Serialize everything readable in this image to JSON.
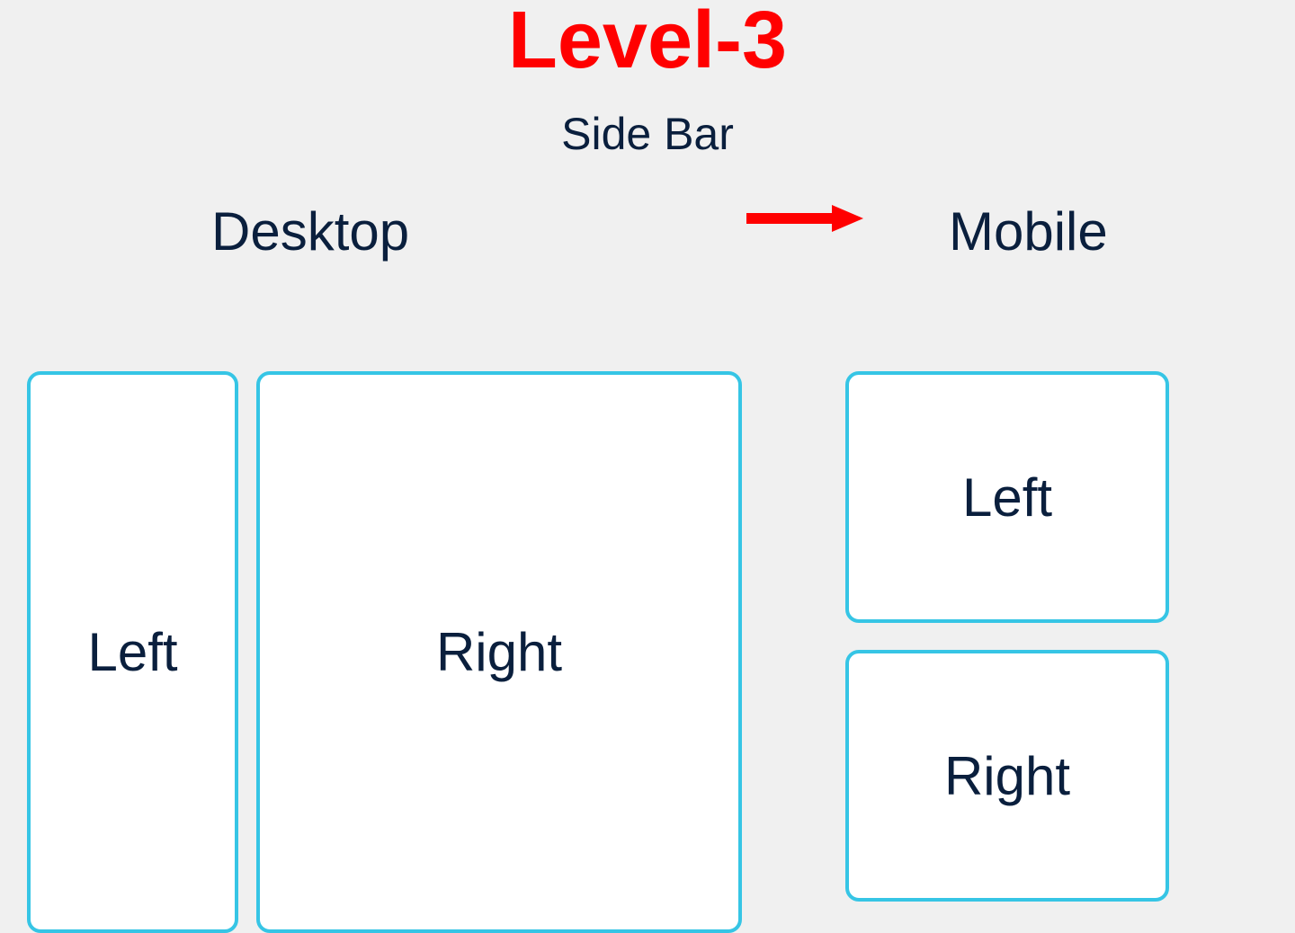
{
  "title": "Level-3",
  "subtitle": "Side Bar",
  "labels": {
    "desktop": "Desktop",
    "mobile": "Mobile"
  },
  "desktop": {
    "left": "Left",
    "right": "Right"
  },
  "mobile": {
    "left": "Left",
    "right": "Right"
  },
  "colors": {
    "title": "#ff0000",
    "text": "#0a1f3d",
    "border": "#36c5e5",
    "arrow": "#ff0000",
    "background": "#f0f0f0"
  }
}
